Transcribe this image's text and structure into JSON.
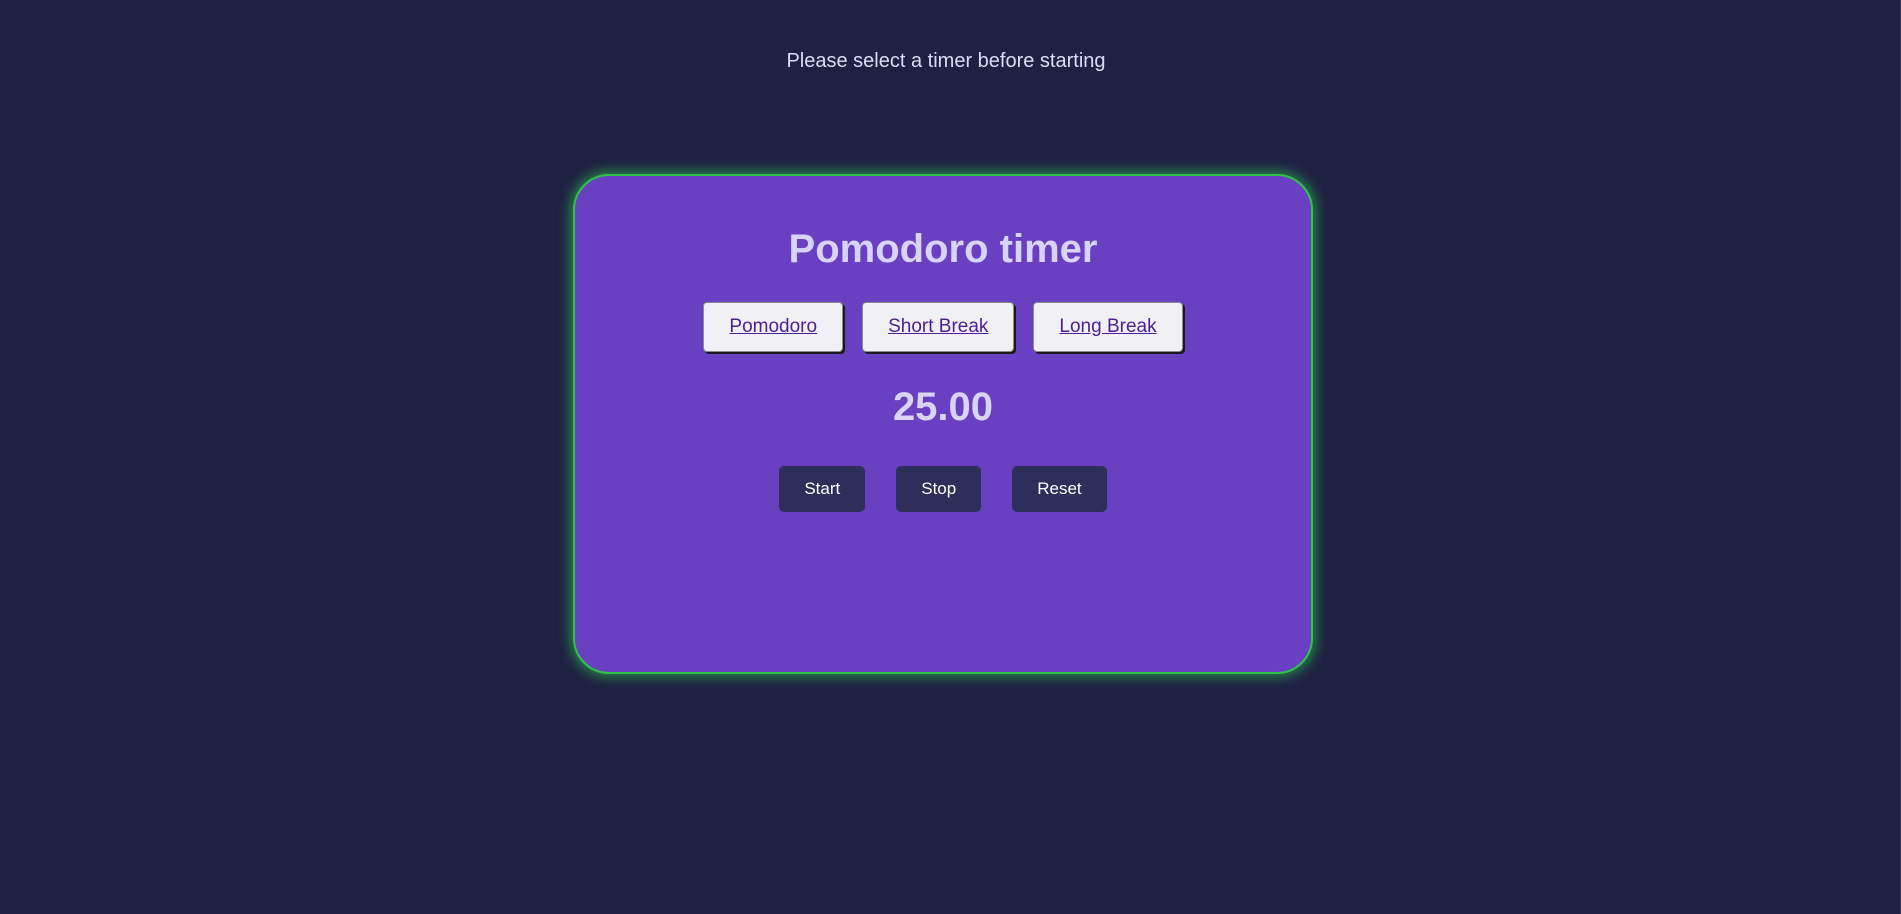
{
  "message": "Please select a timer before starting",
  "card": {
    "title": "Pomodoro timer",
    "modes": [
      "Pomodoro",
      "Short Break",
      "Long Break"
    ],
    "time": "25.00",
    "controls": {
      "start": "Start",
      "stop": "Stop",
      "reset": "Reset"
    }
  },
  "colors": {
    "background": "#1f2142",
    "card": "#6a40c2",
    "card_glow": "#2ec24a",
    "control_button": "#2d2f5a",
    "mode_button_text": "#4c1f94"
  }
}
